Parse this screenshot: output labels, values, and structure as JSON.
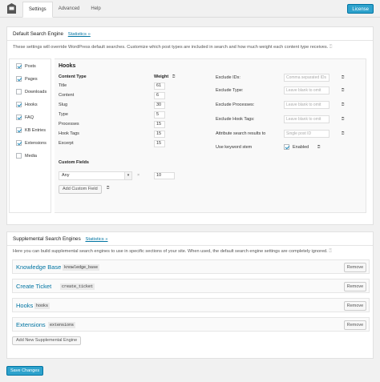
{
  "tabs": [
    {
      "label": "Settings",
      "active": true
    },
    {
      "label": "Advanced",
      "active": false
    },
    {
      "label": "Help",
      "active": false
    }
  ],
  "license_label": "License",
  "default_engine": {
    "title": "Default Search Engine",
    "stats_link": "Statistics »",
    "description": "These settings will override WordPress default searches. Customize which post types are included in search and how much weight each content type receives.",
    "post_types": [
      {
        "label": "Posts",
        "checked": true
      },
      {
        "label": "Pages",
        "checked": true
      },
      {
        "label": "Downloads",
        "checked": false
      },
      {
        "label": "Hooks",
        "checked": true
      },
      {
        "label": "FAQ",
        "checked": true
      },
      {
        "label": "KB Entries",
        "checked": true
      },
      {
        "label": "Extensions",
        "checked": true
      },
      {
        "label": "Media",
        "checked": false
      }
    ],
    "config": {
      "title": "Hooks",
      "content_type_header": "Content Type",
      "weight_header": "Weight",
      "rows": [
        {
          "label": "Title",
          "weight": "61"
        },
        {
          "label": "Content",
          "weight": "6"
        },
        {
          "label": "Slug",
          "weight": "30"
        },
        {
          "label": "Type",
          "weight": "5"
        },
        {
          "label": "Processes",
          "weight": "15"
        },
        {
          "label": "Hook Tags",
          "weight": "15"
        },
        {
          "label": "Excerpt",
          "weight": "15"
        }
      ],
      "right_fields": [
        {
          "label": "Exclude IDs:",
          "placeholder": "Comma separated IDs"
        },
        {
          "label": "Exclude Type:",
          "placeholder": "Leave blank to omit"
        },
        {
          "label": "Exclude Processes:",
          "placeholder": "Leave blank to omit"
        },
        {
          "label": "Exclude Hook Tags:",
          "placeholder": "Leave blank to omit"
        },
        {
          "label": "Attribute search results to",
          "placeholder": "Single post ID"
        }
      ],
      "keyword_stem_label": "Use keyword stem",
      "keyword_stem_value": "Enabled",
      "keyword_stem_checked": true,
      "custom_fields_label": "Custom Fields",
      "custom_field_select": "Any",
      "custom_field_weight": "10",
      "add_custom_field": "Add Custom Field"
    }
  },
  "supplemental": {
    "title": "Supplemental Search Engines",
    "stats_link": "Statistics »",
    "description": "Here you can build supplemental search engines to use in specific sections of your site. When used, the default search engine settings are completely ignored.",
    "engines": [
      {
        "name": "Knowledge Base",
        "slug": "knowledge_base"
      },
      {
        "name": "Create Ticket",
        "slug": "create_ticket"
      },
      {
        "name": "Hooks",
        "slug": "hooks"
      },
      {
        "name": "Extensions",
        "slug": "extensions"
      }
    ],
    "remove_label": "Remove",
    "add_engine": "Add New Supplemental Engine"
  },
  "save_label": "Save Changes",
  "colors": {
    "accent": "#2ea2cc",
    "link": "#0074a2"
  }
}
